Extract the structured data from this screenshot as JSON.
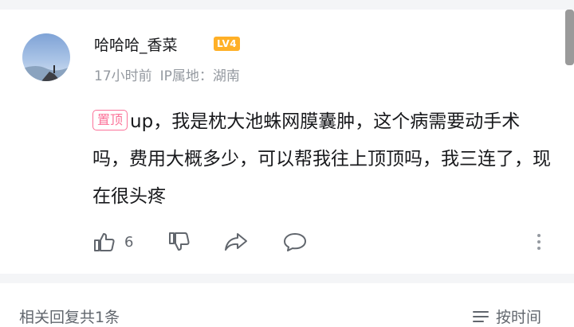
{
  "comment": {
    "user": {
      "name": "哈哈哈_香菜",
      "level": "LV4",
      "level_color": "#ffb027"
    },
    "time": "17小时前",
    "ip_location": "IP属地：湖南",
    "pin_label": "置顶",
    "text": "up，我是枕大池蛛网膜囊肿，这个病需要动手术吗，费用大概多少，可以帮我往上顶顶吗，我三连了，现在很头疼",
    "actions": {
      "like_icon": "thumbs-up-icon",
      "like_count": "6",
      "dislike_icon": "thumbs-down-icon",
      "share_icon": "share-icon",
      "reply_icon": "reply-icon",
      "more_icon": "more-vertical-icon"
    }
  },
  "replies": {
    "count_text": "相关回复共1条",
    "sort_label": "按时间",
    "sort_icon": "sort-lines-icon"
  },
  "colors": {
    "pin": "#fb7299",
    "secondary_text": "#9499a0",
    "divider": "#f4f5f7"
  }
}
